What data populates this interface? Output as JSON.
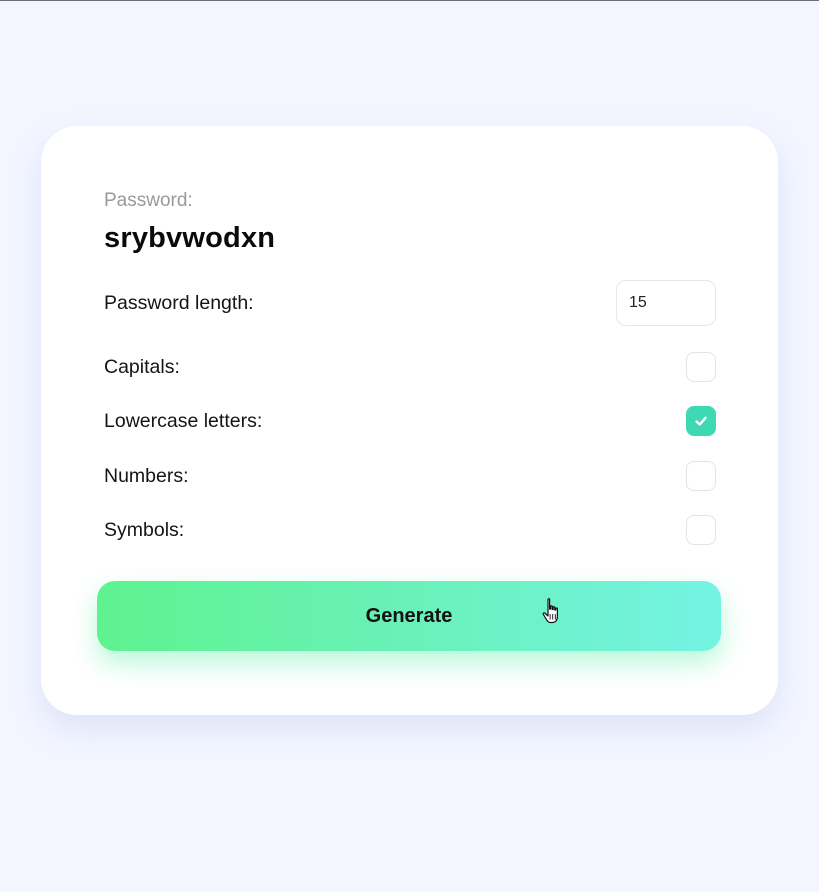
{
  "password": {
    "label": "Password:",
    "value": "srybvwodxn"
  },
  "options": {
    "length": {
      "label": "Password length:",
      "value": "15"
    },
    "capitals": {
      "label": "Capitals:",
      "checked": false
    },
    "lowercase": {
      "label": "Lowercase letters:",
      "checked": true
    },
    "numbers": {
      "label": "Numbers:",
      "checked": false
    },
    "symbols": {
      "label": "Symbols:",
      "checked": false
    }
  },
  "actions": {
    "generate_label": "Generate"
  },
  "colors": {
    "background": "#f3f6ff",
    "card": "#ffffff",
    "checkbox_checked": "#3ed9b2",
    "button_gradient_start": "#5ff28f",
    "button_gradient_end": "#74f3e4"
  },
  "icons": {
    "checkmark": "check-icon",
    "cursor": "hand-pointer-icon"
  }
}
